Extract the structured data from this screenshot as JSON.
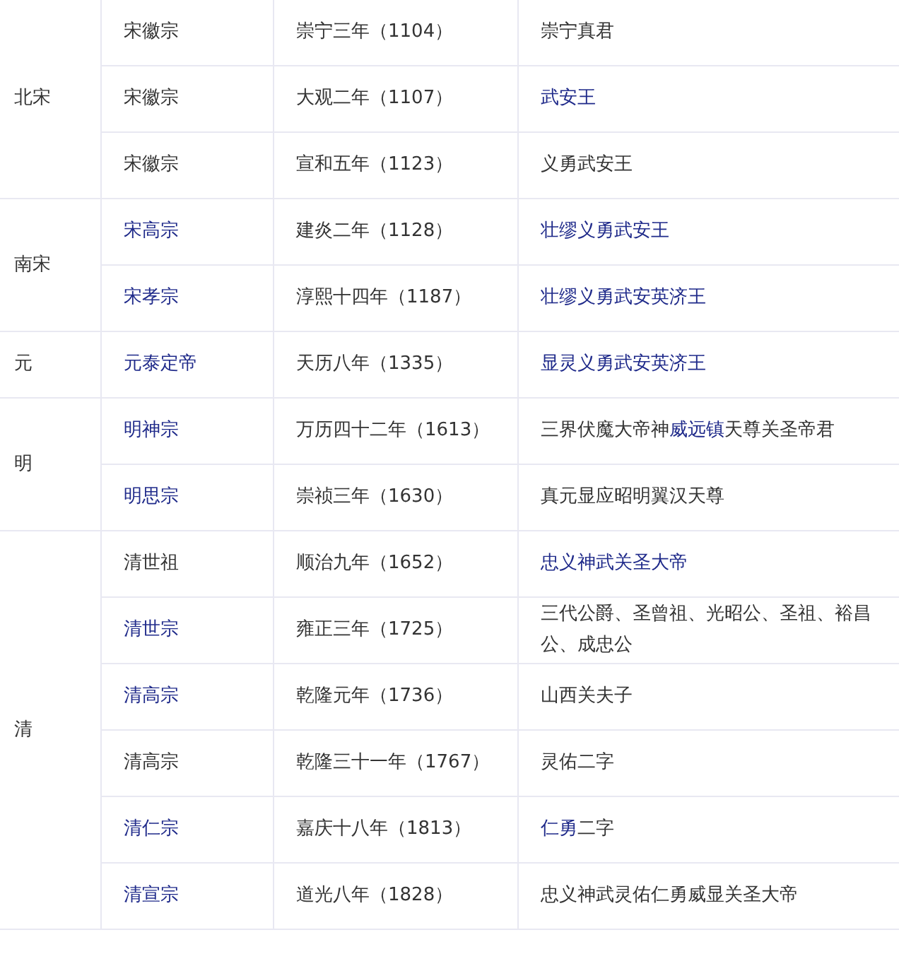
{
  "groups": [
    {
      "dynasty": "北宋",
      "rows": [
        {
          "emperor": "宋徽宗",
          "emperor_link": false,
          "year": "崇宁三年（1104）",
          "title": [
            {
              "text": "崇宁真君",
              "link": false
            }
          ]
        },
        {
          "emperor": "宋徽宗",
          "emperor_link": false,
          "year": "大观二年（1107）",
          "title": [
            {
              "text": "武安王",
              "link": true
            }
          ]
        },
        {
          "emperor": "宋徽宗",
          "emperor_link": false,
          "year": "宣和五年（1123）",
          "title": [
            {
              "text": "义勇武安王",
              "link": false
            }
          ]
        }
      ]
    },
    {
      "dynasty": "南宋",
      "rows": [
        {
          "emperor": "宋高宗",
          "emperor_link": true,
          "year": "建炎二年（1128）",
          "title": [
            {
              "text": "壮缪义勇武安王",
              "link": true
            }
          ]
        },
        {
          "emperor": "宋孝宗",
          "emperor_link": true,
          "year": "淳熙十四年（1187）",
          "title": [
            {
              "text": "壮缪义勇武安英济王",
              "link": true
            }
          ]
        }
      ]
    },
    {
      "dynasty": "元",
      "rows": [
        {
          "emperor": "元泰定帝",
          "emperor_link": true,
          "year": "天历八年（1335）",
          "title": [
            {
              "text": "显灵义勇武安英济王",
              "link": true
            }
          ]
        }
      ]
    },
    {
      "dynasty": "明",
      "rows": [
        {
          "emperor": "明神宗",
          "emperor_link": true,
          "year": "万历四十二年（1613）",
          "title": [
            {
              "text": "三界伏魔大帝神",
              "link": false
            },
            {
              "text": "威远镇",
              "link": true
            },
            {
              "text": "天尊关圣帝君",
              "link": false
            }
          ]
        },
        {
          "emperor": "明思宗",
          "emperor_link": true,
          "year": "崇祯三年（1630）",
          "title": [
            {
              "text": "真元显应昭明翼汉天尊",
              "link": false
            }
          ]
        }
      ]
    },
    {
      "dynasty": "清",
      "rows": [
        {
          "emperor": "清世祖",
          "emperor_link": false,
          "year": "顺治九年（1652）",
          "title": [
            {
              "text": "忠义神武关圣大帝",
              "link": true
            }
          ]
        },
        {
          "emperor": "清世宗",
          "emperor_link": true,
          "year": "雍正三年（1725）",
          "title": [
            {
              "text": "三代公爵、圣曾祖、光昭公、圣祖、裕昌公、成忠公",
              "link": false
            }
          ]
        },
        {
          "emperor": "清高宗",
          "emperor_link": true,
          "year": "乾隆元年（1736）",
          "title": [
            {
              "text": "山西关夫子",
              "link": false
            }
          ]
        },
        {
          "emperor": "清高宗",
          "emperor_link": false,
          "year": "乾隆三十一年（1767）",
          "title": [
            {
              "text": "灵佑二字",
              "link": false
            }
          ]
        },
        {
          "emperor": "清仁宗",
          "emperor_link": true,
          "year": "嘉庆十八年（1813）",
          "title": [
            {
              "text": "仁勇",
              "link": true
            },
            {
              "text": "二字",
              "link": false
            }
          ]
        },
        {
          "emperor": "清宣宗",
          "emperor_link": true,
          "year": "道光八年（1828）",
          "title": [
            {
              "text": "忠义神武灵佑仁勇威显关圣大帝",
              "link": false
            }
          ]
        }
      ]
    }
  ]
}
